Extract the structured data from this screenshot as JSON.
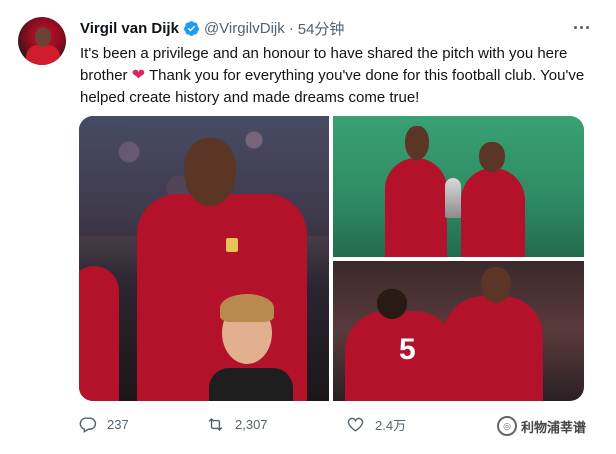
{
  "tweet": {
    "author_name": "Virgil van Dijk",
    "handle": "@VirgilvDijk",
    "separator": "·",
    "time": "54分钟",
    "text_before_heart": "It's been a privilege and an honour to have shared the pitch with you here brother ",
    "heart": "❤",
    "text_after_heart": " Thank you for everything you've done for this football club. You've helped create history and made dreams come true!",
    "verified_color": "#1d9bf0"
  },
  "media": {
    "images": [
      {
        "icon": "photo-player-anthem"
      },
      {
        "icon": "photo-players-trophy"
      },
      {
        "icon": "photo-players-celebration"
      }
    ]
  },
  "actions": {
    "replies": "237",
    "retweets": "2,307",
    "likes": "2.4万"
  },
  "watermark": {
    "text": "利物浦莘谱"
  }
}
